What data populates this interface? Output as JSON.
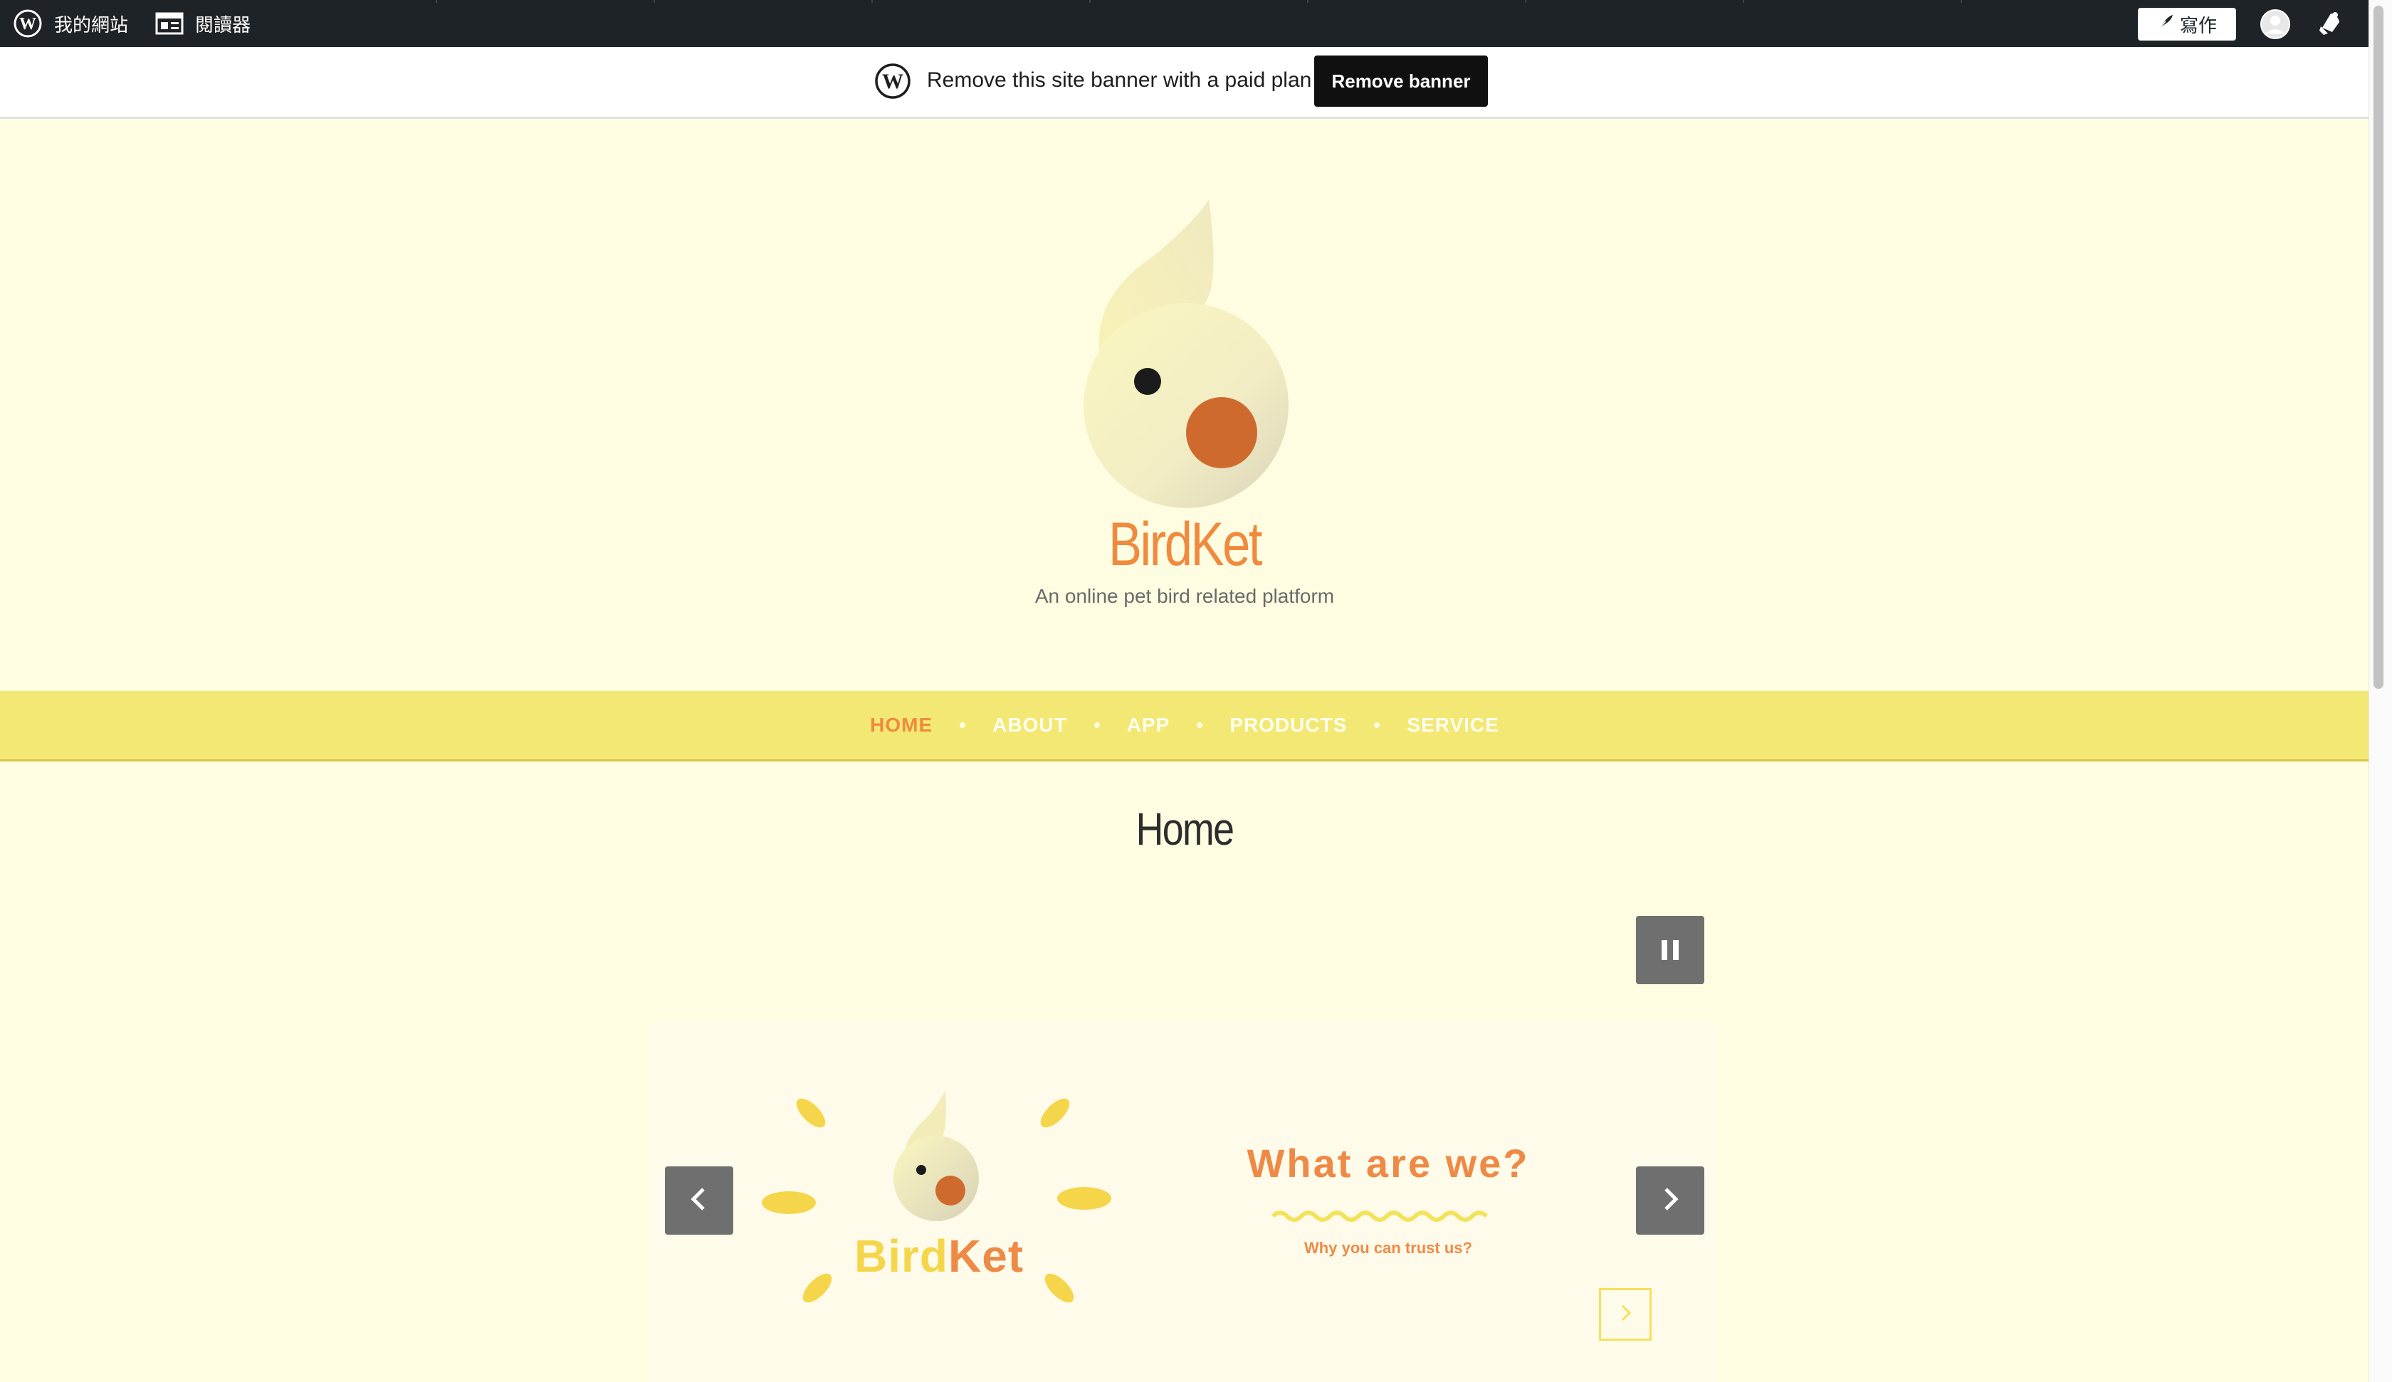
{
  "adminbar": {
    "my_site": "我的網站",
    "reader": "閱讀器",
    "write": "寫作"
  },
  "banner": {
    "text": "Remove this site banner with a paid plan",
    "button": "Remove banner"
  },
  "site": {
    "title": "BirdKet",
    "description": "An online pet bird related platform"
  },
  "nav": {
    "items": [
      {
        "label": "HOME"
      },
      {
        "label": "ABOUT"
      },
      {
        "label": "APP"
      },
      {
        "label": "PRODUCTS"
      },
      {
        "label": "SERVICE"
      }
    ],
    "active": "HOME"
  },
  "page": {
    "title": "Home"
  },
  "slider": {
    "logo_text_left": "Bird",
    "logo_text_right": "Ket",
    "heading": "What are we?",
    "subheading": "Why you can trust us?"
  },
  "colors": {
    "brand_orange": "#f08a3e",
    "nav_yellow": "#f3e874",
    "page_bg": "#fffde1",
    "admin_bar": "#1d2327"
  },
  "icons": {
    "admin_logo": "wordpress-icon",
    "reader": "reader-icon",
    "write": "pen-icon",
    "avatar": "avatar-icon",
    "notifications": "bell-icon",
    "pause": "pause-icon",
    "prev": "chevron-left-icon",
    "next": "chevron-right-icon"
  }
}
